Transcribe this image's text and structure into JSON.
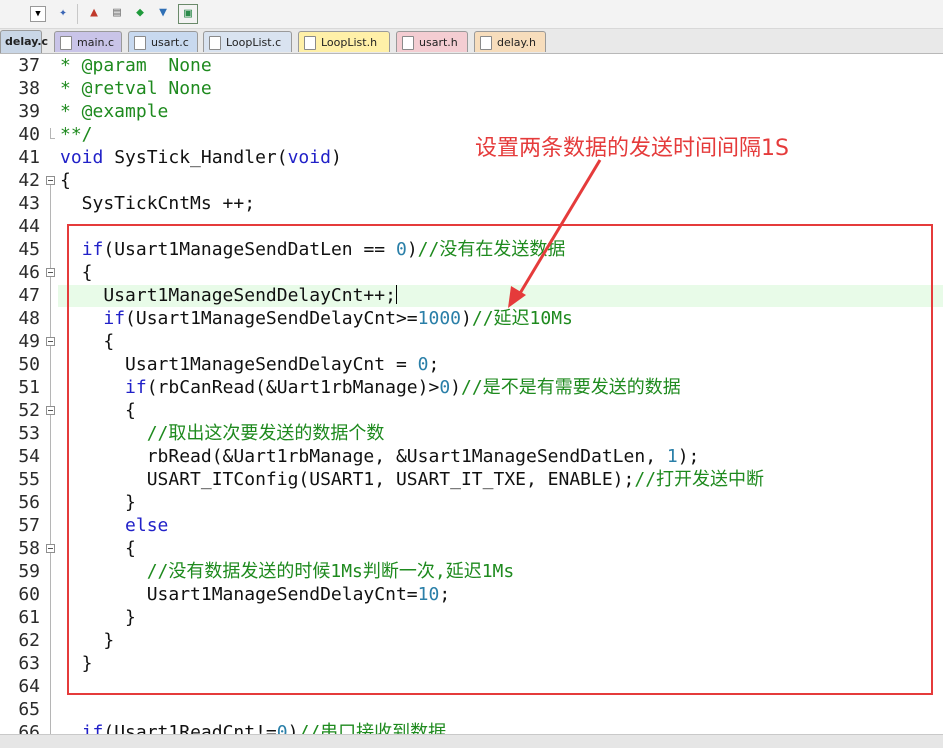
{
  "tabs": [
    {
      "label": "delay.c",
      "active": true,
      "color": "#c9d6e6"
    },
    {
      "label": "main.c",
      "color": "#c9c4e8"
    },
    {
      "label": "usart.c",
      "color": "#c8d9ef"
    },
    {
      "label": "LoopList.c",
      "color": "#d9e3f0"
    },
    {
      "label": "LoopList.h",
      "color": "#fff0a8"
    },
    {
      "label": "usart.h",
      "color": "#f4cdd2"
    },
    {
      "label": "delay.h",
      "color": "#f7ddbc"
    }
  ],
  "toolbar_icons": [
    "dropdown-icon",
    "wand-icon",
    "build-icon",
    "windows-icon",
    "diamond-icon",
    "download-icon",
    "flash-icon"
  ],
  "annotation": "设置两条数据的发送时间间隔1S",
  "lines": [
    {
      "n": "37",
      "t": "* @param  None"
    },
    {
      "n": "38",
      "t": "* @retval None"
    },
    {
      "n": "39",
      "t": "* @example"
    },
    {
      "n": "40",
      "t": "**/"
    },
    {
      "n": "41",
      "t": "void SysTick_Handler(void)"
    },
    {
      "n": "42",
      "t": "{"
    },
    {
      "n": "43",
      "t": "  SysTickCntMs ++;"
    },
    {
      "n": "44",
      "t": ""
    },
    {
      "n": "45",
      "t": "  if(Usart1ManageSendDatLen == 0)//没有在发送数据"
    },
    {
      "n": "46",
      "t": "  {"
    },
    {
      "n": "47",
      "t": "    Usart1ManageSendDelayCnt++;"
    },
    {
      "n": "48",
      "t": "    if(Usart1ManageSendDelayCnt>=1000)//延迟10Ms"
    },
    {
      "n": "49",
      "t": "    {"
    },
    {
      "n": "50",
      "t": "      Usart1ManageSendDelayCnt = 0;"
    },
    {
      "n": "51",
      "t": "      if(rbCanRead(&Uart1rbManage)>0)//是不是有需要发送的数据"
    },
    {
      "n": "52",
      "t": "      {"
    },
    {
      "n": "53",
      "t": "        //取出这次要发送的数据个数"
    },
    {
      "n": "54",
      "t": "        rbRead(&Uart1rbManage, &Usart1ManageSendDatLen, 1);"
    },
    {
      "n": "55",
      "t": "        USART_ITConfig(USART1, USART_IT_TXE, ENABLE);//打开发送中断"
    },
    {
      "n": "56",
      "t": "      }"
    },
    {
      "n": "57",
      "t": "      else"
    },
    {
      "n": "58",
      "t": "      {"
    },
    {
      "n": "59",
      "t": "        //没有数据发送的时候1Ms判断一次,延迟1Ms"
    },
    {
      "n": "60",
      "t": "        Usart1ManageSendDelayCnt=10;"
    },
    {
      "n": "61",
      "t": "      }"
    },
    {
      "n": "62",
      "t": "    }"
    },
    {
      "n": "63",
      "t": "  }"
    },
    {
      "n": "64",
      "t": ""
    },
    {
      "n": "65",
      "t": ""
    },
    {
      "n": "66",
      "t": "  if(Usart1ReadCnt!=0)//串口接收到数据"
    }
  ],
  "colors": {
    "keyword": "#2121c8",
    "comment": "#1e8a1e",
    "number": "#2a7fa8",
    "annotation": "#e53b3b",
    "current_line": "#e8fbe8"
  }
}
